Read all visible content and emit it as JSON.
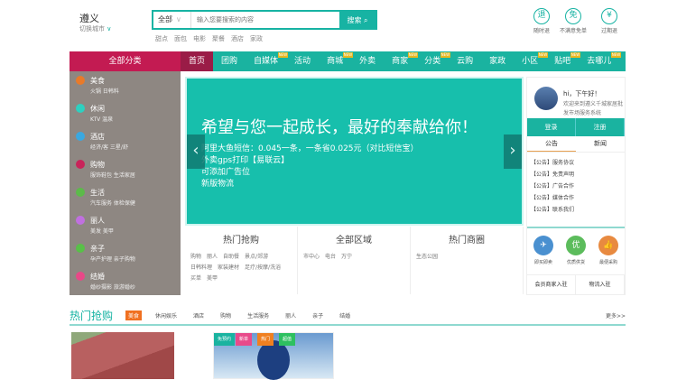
{
  "header": {
    "city": "遵义",
    "switch_city": "切换城市",
    "switch_chev": "∨",
    "search_category": "全部",
    "search_caret": "∨",
    "search_placeholder": "输入您要搜索的内容",
    "search_button": "搜索",
    "search_icon": "⌕",
    "hot_words": [
      "甜点",
      "面包",
      "电影",
      "聚餐",
      "酒店",
      "家政"
    ],
    "guarantees": [
      {
        "icon": "退",
        "label": "随时退"
      },
      {
        "icon": "免",
        "label": "不满意免单"
      },
      {
        "icon": "¥",
        "label": "过期退"
      }
    ]
  },
  "nav": {
    "all_categories": "全部分类",
    "items": [
      {
        "label": "首页",
        "new": false
      },
      {
        "label": "团购",
        "new": false
      },
      {
        "label": "自媒体",
        "new": true
      },
      {
        "label": "活动",
        "new": false
      },
      {
        "label": "商城",
        "new": true
      },
      {
        "label": "外卖",
        "new": false
      },
      {
        "label": "商家",
        "new": true
      },
      {
        "label": "分类",
        "new": true
      },
      {
        "label": "云购",
        "new": false
      },
      {
        "label": "家政",
        "new": false
      },
      {
        "label": "小区",
        "new": true
      },
      {
        "label": "贴吧",
        "new": true
      },
      {
        "label": "去哪儿",
        "new": true
      }
    ],
    "new_badge": "NEW"
  },
  "sidebar": [
    {
      "title": "美食",
      "sub": "火锅  日韩料",
      "color": "#e87a2a"
    },
    {
      "title": "休闲",
      "sub": "KTV  温泉",
      "color": "#2ed0c0"
    },
    {
      "title": "酒店",
      "sub": "经济/客  三星/舒",
      "color": "#3aa8e0"
    },
    {
      "title": "购物",
      "sub": "服饰鞋包  生活家居",
      "color": "#c8245a"
    },
    {
      "title": "生活",
      "sub": "汽车服务  体检保健",
      "color": "#5cba4a"
    },
    {
      "title": "丽人",
      "sub": "美发  美甲",
      "color": "#c070e0"
    },
    {
      "title": "亲子",
      "sub": "孕产护理  亲子购物",
      "color": "#58c048"
    },
    {
      "title": "结婚",
      "sub": "婚纱摄影  旅游婚纱",
      "color": "#e84888"
    }
  ],
  "banner": {
    "headline": "希望与您一起成长，最好的奉献给你！",
    "lines": [
      "阿里大鱼短信：0.045一条，一条省0.025元（对比短信宝）",
      "外卖gps打印【易联云】",
      "可添加广告位",
      "新版物流"
    ],
    "prev": "‹",
    "next": "›"
  },
  "columns": [
    {
      "title": "热门抢购",
      "links": [
        "购物",
        "丽人",
        "自助餐",
        "景点/郊游",
        "日韩料理",
        "家装建材",
        "足疗/按摩/洗浴",
        "买单",
        "美甲"
      ]
    },
    {
      "title": "全部区域",
      "links": [
        "市中心",
        "电台",
        "万宁"
      ]
    },
    {
      "title": "热门商圈",
      "links": [
        "生态公园"
      ]
    }
  ],
  "user_panel": {
    "greeting": "hi，下午好！",
    "welcome": "欢迎来到遵义千城家居批发市场服务系统",
    "login": "登录",
    "register": "注册",
    "tabs": [
      "公告",
      "新闻"
    ],
    "notices": [
      "【公告】服务协议",
      "【公告】免责声明",
      "【公告】广告合作",
      "【公告】媒体合作",
      "【公告】联系我们"
    ],
    "services": [
      {
        "icon": "✈",
        "label": "即买即卖",
        "color": "#4a90d0"
      },
      {
        "icon": "优",
        "label": "优质供货",
        "color": "#5cbc5c"
      },
      {
        "icon": "👍",
        "label": "最便采购",
        "color": "#e88a40"
      }
    ],
    "join": [
      "会员商家入驻",
      "物流入驻"
    ]
  },
  "hot_deals": {
    "title": "热门抢购",
    "tabs": [
      "美食",
      "休闲娱乐",
      "酒店",
      "购物",
      "生活服务",
      "丽人",
      "亲子",
      "结婚"
    ],
    "more": "更多>>",
    "image_tags": [
      {
        "label": "免预约",
        "color": "#1ab3a0"
      },
      {
        "label": "新单",
        "color": "#e84a8a"
      },
      {
        "label": "热门",
        "color": "#f08020"
      },
      {
        "label": "超值",
        "color": "#2ec060"
      }
    ]
  }
}
